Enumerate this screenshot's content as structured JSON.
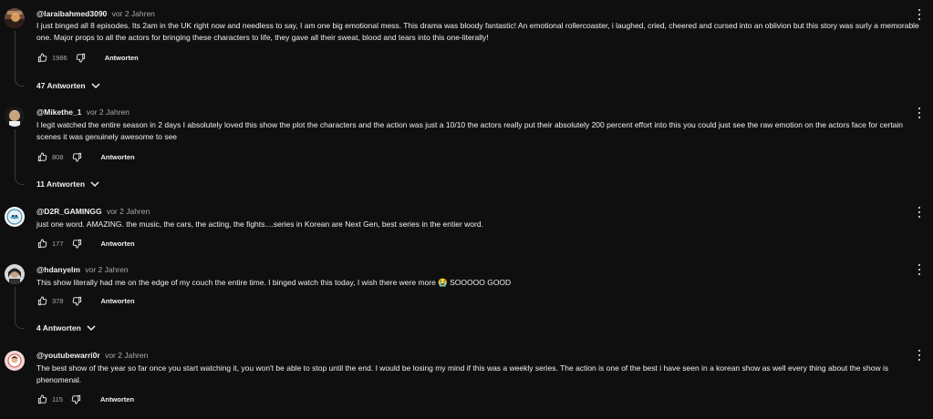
{
  "comments": [
    {
      "author": "@laraibahmed3090",
      "time": "vor 2 Jahren",
      "text": "I just binged all 8 episodes. Its 2am in the UK right now and needless to say, I am one big emotional mess. This drama was bloody fantastic! An emotional rollercoaster, i laughed, cried, cheered and cursed into an oblivion but this story was surly a memorable one. Major props to all the actors for bringing these characters to life, they gave all their sweat, blood and tears into this one-literally!",
      "likes": "1986",
      "reply_label": "Antworten",
      "replies_label": "47 Antworten"
    },
    {
      "author": "@Mikethe_1",
      "time": "vor 2 Jahren",
      "text": "I legit watched the entire season in 2 days I absolutely loved this show the  plot the characters and the action was just a 10/10 the actors really put their absolutely 200 percent effort into this you could just see the raw emotion on the actors face for certain scenes it was genuinely awesome to see",
      "likes": "808",
      "reply_label": "Antworten",
      "replies_label": "11 Antworten"
    },
    {
      "author": "@D2R_GAMINGG",
      "time": "vor 2 Jahren",
      "text": "just one word. AMAZING. the music, the cars, the acting, the fights....series in Korean are Next Gen, best series in the entier word.",
      "likes": "177",
      "reply_label": "Antworten"
    },
    {
      "author": "@hdanyelm",
      "time": "vor 2 Jahren",
      "text": "This show literally had me on the edge of my couch the entire time. I binged watch this today, I wish there were more 😭 SOOOOO GOOD",
      "likes": "378",
      "reply_label": "Antworten",
      "replies_label": "4 Antworten"
    },
    {
      "author": "@youtubewarri0r",
      "time": "vor 2 Jahren",
      "text": "The best show of the year so far once you start watching it, you won't be able to stop until the end. I would be losing my mind if this was a weekly series. The action is one of the best i have seen in a korean show as well every thing about the show is phenomenal.",
      "likes": "115",
      "reply_label": "Antworten"
    }
  ]
}
